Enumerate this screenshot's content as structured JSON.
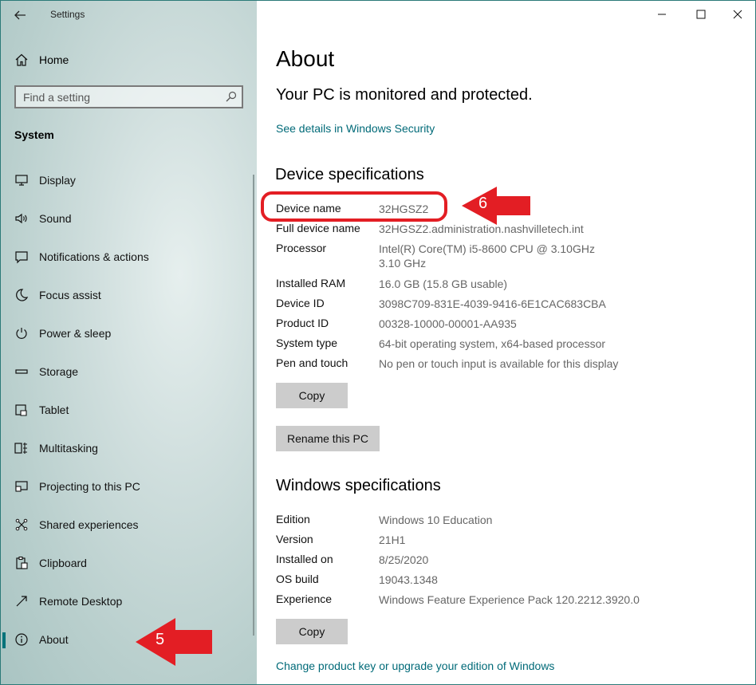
{
  "app": {
    "title": "Settings"
  },
  "sidebar": {
    "home_label": "Home",
    "search_placeholder": "Find a setting",
    "section_title": "System",
    "items": [
      {
        "label": "Display",
        "icon": "monitor-icon"
      },
      {
        "label": "Sound",
        "icon": "speaker-icon"
      },
      {
        "label": "Notifications & actions",
        "icon": "notification-icon"
      },
      {
        "label": "Focus assist",
        "icon": "moon-icon"
      },
      {
        "label": "Power & sleep",
        "icon": "power-icon"
      },
      {
        "label": "Storage",
        "icon": "storage-icon"
      },
      {
        "label": "Tablet",
        "icon": "tablet-icon"
      },
      {
        "label": "Multitasking",
        "icon": "multitasking-icon"
      },
      {
        "label": "Projecting to this PC",
        "icon": "projecting-icon"
      },
      {
        "label": "Shared experiences",
        "icon": "shared-icon"
      },
      {
        "label": "Clipboard",
        "icon": "clipboard-icon"
      },
      {
        "label": "Remote Desktop",
        "icon": "remote-desktop-icon"
      },
      {
        "label": "About",
        "icon": "info-icon",
        "selected": true
      }
    ]
  },
  "main": {
    "title": "About",
    "protection_status": "Your PC is monitored and protected.",
    "security_link": "See details in Windows Security",
    "device_specs": {
      "heading": "Device specifications",
      "rows": [
        {
          "key": "Device name",
          "value": "32HGSZ2"
        },
        {
          "key": "Full device name",
          "value": "32HGSZ2.administration.nashvilletech.int"
        },
        {
          "key": "Processor",
          "value": "Intel(R) Core(TM) i5-8600 CPU @ 3.10GHz   3.10 GHz"
        },
        {
          "key": "Installed RAM",
          "value": "16.0 GB (15.8 GB usable)"
        },
        {
          "key": "Device ID",
          "value": "3098C709-831E-4039-9416-6E1CAC683CBA"
        },
        {
          "key": "Product ID",
          "value": "00328-10000-00001-AA935"
        },
        {
          "key": "System type",
          "value": "64-bit operating system, x64-based processor"
        },
        {
          "key": "Pen and touch",
          "value": "No pen or touch input is available for this display"
        }
      ],
      "copy_label": "Copy",
      "rename_label": "Rename this PC"
    },
    "windows_specs": {
      "heading": "Windows specifications",
      "rows": [
        {
          "key": "Edition",
          "value": "Windows 10 Education"
        },
        {
          "key": "Version",
          "value": "21H1"
        },
        {
          "key": "Installed on",
          "value": "8/25/2020"
        },
        {
          "key": "OS build",
          "value": "19043.1348"
        },
        {
          "key": "Experience",
          "value": "Windows Feature Experience Pack 120.2212.3920.0"
        }
      ],
      "copy_label": "Copy"
    },
    "product_key_link": "Change product key or upgrade your edition of Windows"
  },
  "annotations": {
    "arrow_5": "5",
    "arrow_6": "6",
    "color": "#e31e24"
  }
}
